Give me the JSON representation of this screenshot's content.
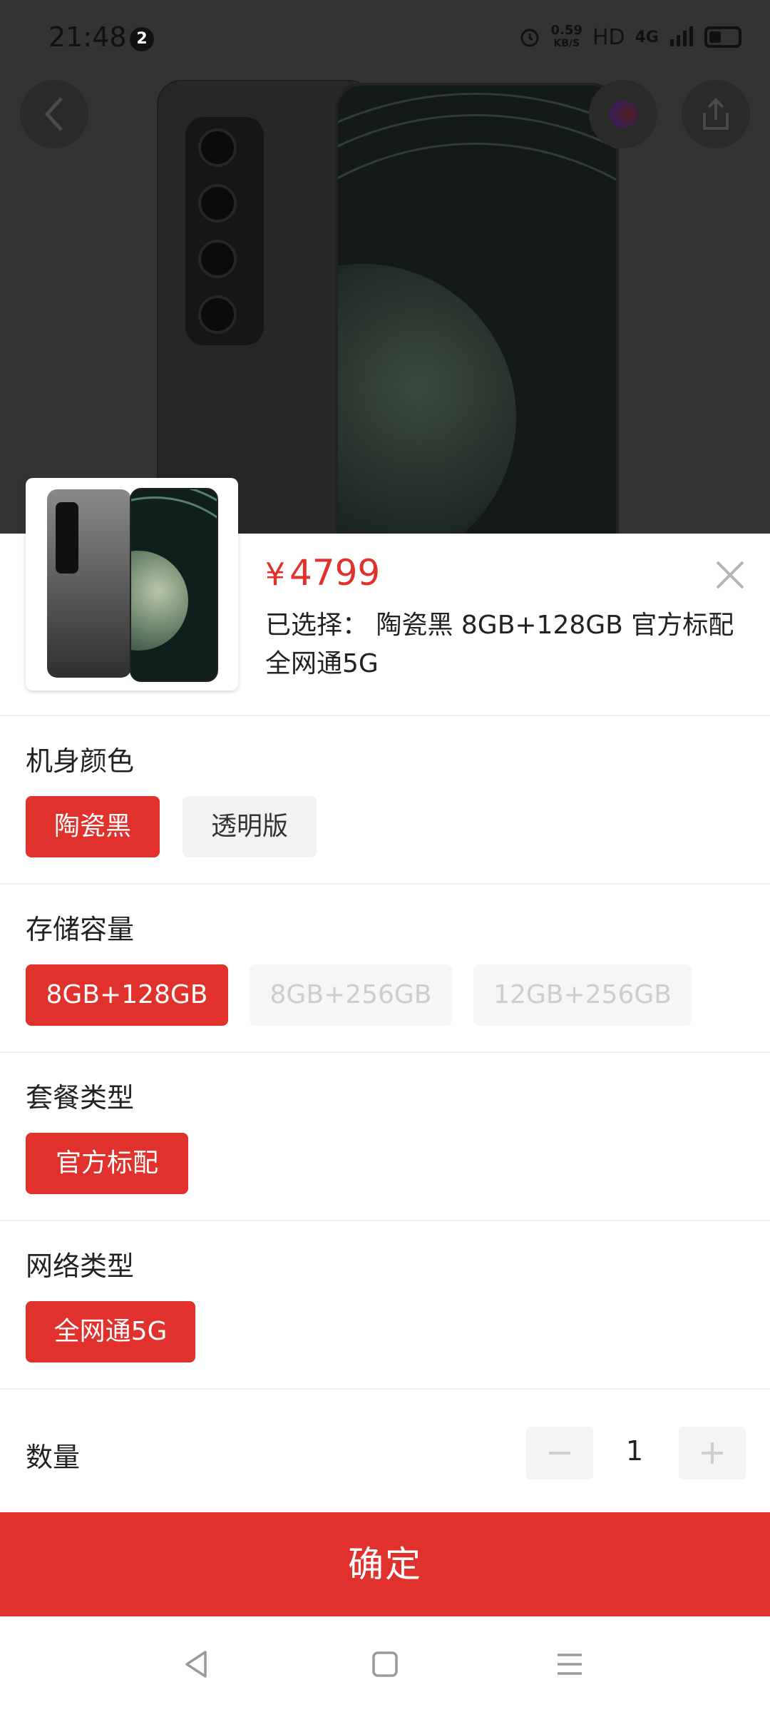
{
  "status_bar": {
    "time": "21:48",
    "notification_count": "2",
    "net_speed_value": "0.59",
    "net_speed_unit": "KB/S",
    "hd": "HD",
    "network": "4G",
    "icons": [
      "alarm-icon",
      "signal-icon",
      "battery-icon"
    ]
  },
  "product": {
    "price_symbol": "¥",
    "price": "4799",
    "selected_text": "已选择： 陶瓷黑 8GB+128GB 官方标配 全网通5G"
  },
  "sections": [
    {
      "title": "机身颜色",
      "options": [
        {
          "label": "陶瓷黑",
          "state": "active"
        },
        {
          "label": "透明版",
          "state": "normal"
        }
      ]
    },
    {
      "title": "存储容量",
      "options": [
        {
          "label": "8GB+128GB",
          "state": "active"
        },
        {
          "label": "8GB+256GB",
          "state": "disabled"
        },
        {
          "label": "12GB+256GB",
          "state": "disabled"
        }
      ]
    },
    {
      "title": "套餐类型",
      "options": [
        {
          "label": "官方标配",
          "state": "active"
        }
      ]
    },
    {
      "title": "网络类型",
      "options": [
        {
          "label": "全网通5G",
          "state": "active"
        }
      ]
    }
  ],
  "quantity": {
    "label": "数量",
    "value": "1"
  },
  "confirm_label": "确定",
  "colors": {
    "accent": "#e0312c",
    "chip_bg": "#f2f2f2",
    "disabled_text": "#cdcdcd"
  }
}
